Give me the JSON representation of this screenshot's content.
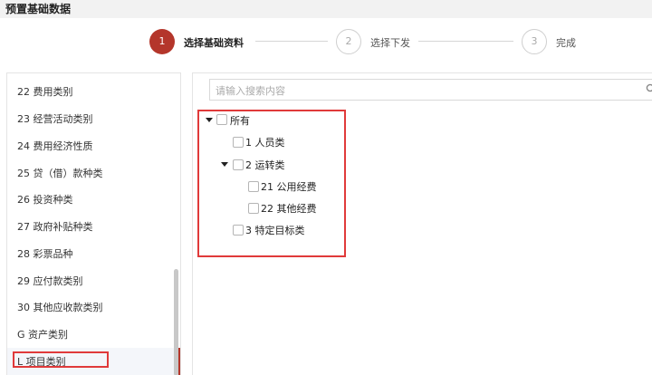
{
  "header": {
    "title": "预置基础数据"
  },
  "steps": [
    {
      "number": "1",
      "label": "选择基础资料",
      "state": "active"
    },
    {
      "number": "2",
      "label": "选择下发",
      "state": "inactive"
    },
    {
      "number": "3",
      "label": "完成",
      "state": "inactive"
    }
  ],
  "colors": {
    "accent": "#b4362b",
    "highlight": "#e03a3a"
  },
  "left_list": {
    "items": [
      "22 费用类别",
      "23 经营活动类别",
      "24 费用经济性质",
      "25 贷（借）款种类",
      "26 投资种类",
      "27 政府补贴种类",
      "28 彩票品种",
      "29 应付款类别",
      "30 其他应收款类别",
      "G 资产类别",
      "L 项目类别"
    ],
    "selected": "L 项目类别"
  },
  "search": {
    "placeholder": "请输入搜索内容",
    "icon": "search-icon"
  },
  "tree": {
    "root": "所有",
    "n1": "1 人员类",
    "n2": "2 运转类",
    "n21": "21 公用经费",
    "n22": "22 其他经费",
    "n3": "3 特定目标类"
  }
}
